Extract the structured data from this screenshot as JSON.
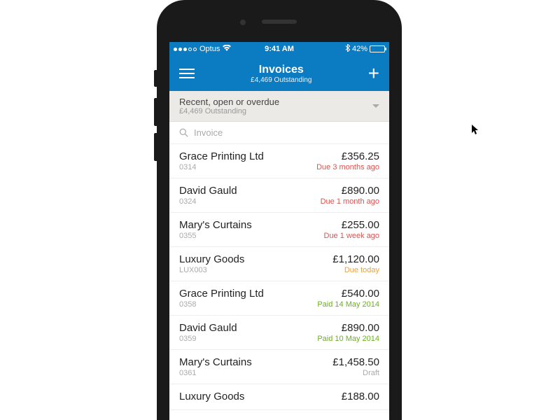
{
  "status_bar": {
    "carrier": "Optus",
    "time": "9:41 AM",
    "battery_percent": "42%"
  },
  "nav": {
    "title": "Invoices",
    "subtitle": "£4,469 Outstanding"
  },
  "filter": {
    "title": "Recent, open or overdue",
    "subtitle": "£4,469 Outstanding"
  },
  "search": {
    "placeholder": "Invoice"
  },
  "invoices": [
    {
      "name": "Grace Printing Ltd",
      "ref": "0314",
      "amount": "£356.25",
      "status": "Due 3 months ago",
      "status_class": "overdue"
    },
    {
      "name": "David Gauld",
      "ref": "0324",
      "amount": "£890.00",
      "status": "Due 1 month ago",
      "status_class": "overdue"
    },
    {
      "name": "Mary's Curtains",
      "ref": "0355",
      "amount": "£255.00",
      "status": "Due 1 week ago",
      "status_class": "overdue"
    },
    {
      "name": "Luxury Goods",
      "ref": "LUX003",
      "amount": "£1,120.00",
      "status": "Due today",
      "status_class": "today"
    },
    {
      "name": "Grace Printing Ltd",
      "ref": "0358",
      "amount": "£540.00",
      "status": "Paid 14 May 2014",
      "status_class": "paid"
    },
    {
      "name": "David Gauld",
      "ref": "0359",
      "amount": "£890.00",
      "status": "Paid 10 May 2014",
      "status_class": "paid"
    },
    {
      "name": "Mary's Curtains",
      "ref": "0361",
      "amount": "£1,458.50",
      "status": "Draft",
      "status_class": "draft"
    },
    {
      "name": "Luxury Goods",
      "ref": "",
      "amount": "£188.00",
      "status": "",
      "status_class": "draft"
    }
  ]
}
